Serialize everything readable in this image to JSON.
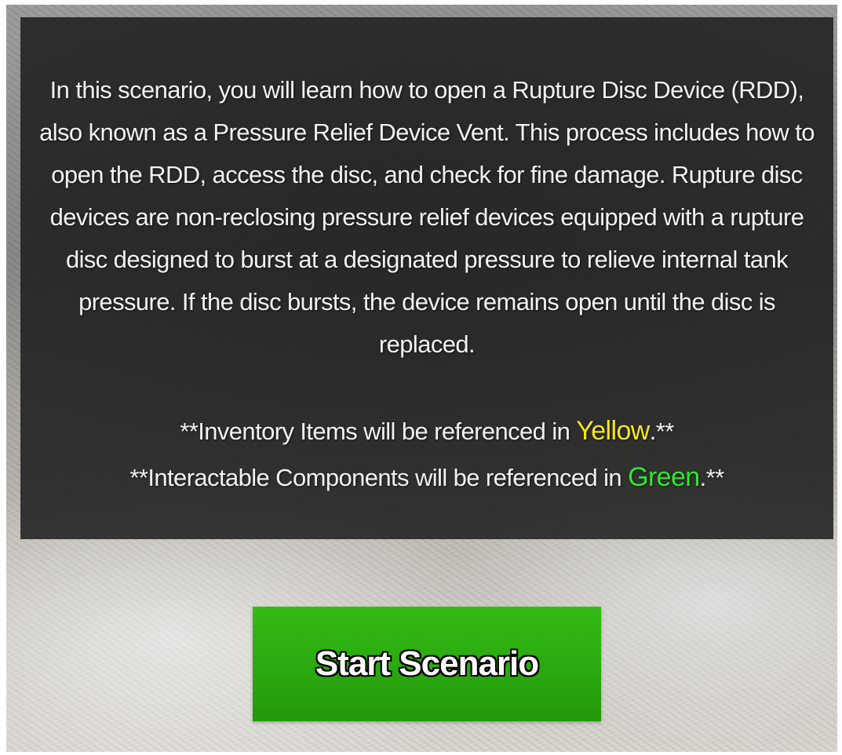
{
  "intro": {
    "text": "In this scenario, you will learn how to open a Rupture Disc Device (RDD), also known as a Pressure Relief Device Vent. This process includes how to open the RDD, access the disc, and check for fine damage. Rupture disc devices are non-reclosing pressure relief devices equipped with a rupture disc designed to burst at a designated pressure to relieve internal tank pressure. If the disc bursts, the device remains open until the disc is replaced."
  },
  "notes": {
    "inventory_prefix": "**Inventory Items will be referenced in ",
    "inventory_highlight": "Yellow",
    "inventory_suffix": ".**",
    "interactable_prefix": "**Interactable Components will be referenced in ",
    "interactable_highlight": "Green",
    "interactable_suffix": ".**"
  },
  "button": {
    "start_label": "Start Scenario"
  },
  "colors": {
    "inventory_highlight": "#f4e81a",
    "interactable_highlight": "#2ee82e",
    "button_green": "#2aa90f",
    "panel": "#1c1c1c"
  }
}
